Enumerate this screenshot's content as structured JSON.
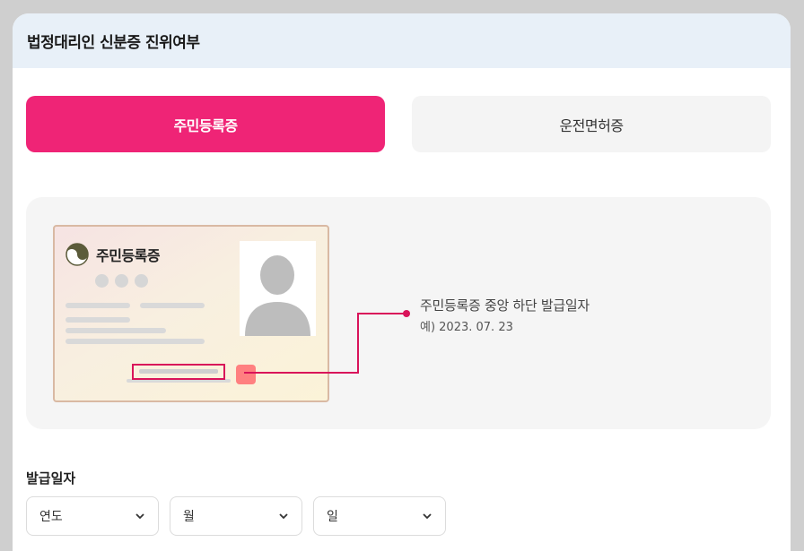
{
  "header": {
    "title": "법정대리인 신분증 진위여부"
  },
  "tabs": [
    {
      "label": "주민등록증",
      "active": true
    },
    {
      "label": "운전면허증",
      "active": false
    }
  ],
  "illustration": {
    "card_title": "주민등록증",
    "callout_title": "주민등록증 중앙 하단 발급일자",
    "callout_example": "예) 2023. 07. 23",
    "accent_color": "#d9145a"
  },
  "form": {
    "issue_date_label": "발급일자",
    "selects": [
      {
        "name": "year",
        "value": "연도",
        "icon": "chevron-down-icon"
      },
      {
        "name": "month",
        "value": "월",
        "icon": "chevron-down-icon"
      },
      {
        "name": "day",
        "value": "일",
        "icon": "chevron-down-icon"
      }
    ]
  },
  "colors": {
    "primary": "#ef2476",
    "header_bg": "#e8f0f8",
    "panel_bg": "#f5f5f5"
  }
}
